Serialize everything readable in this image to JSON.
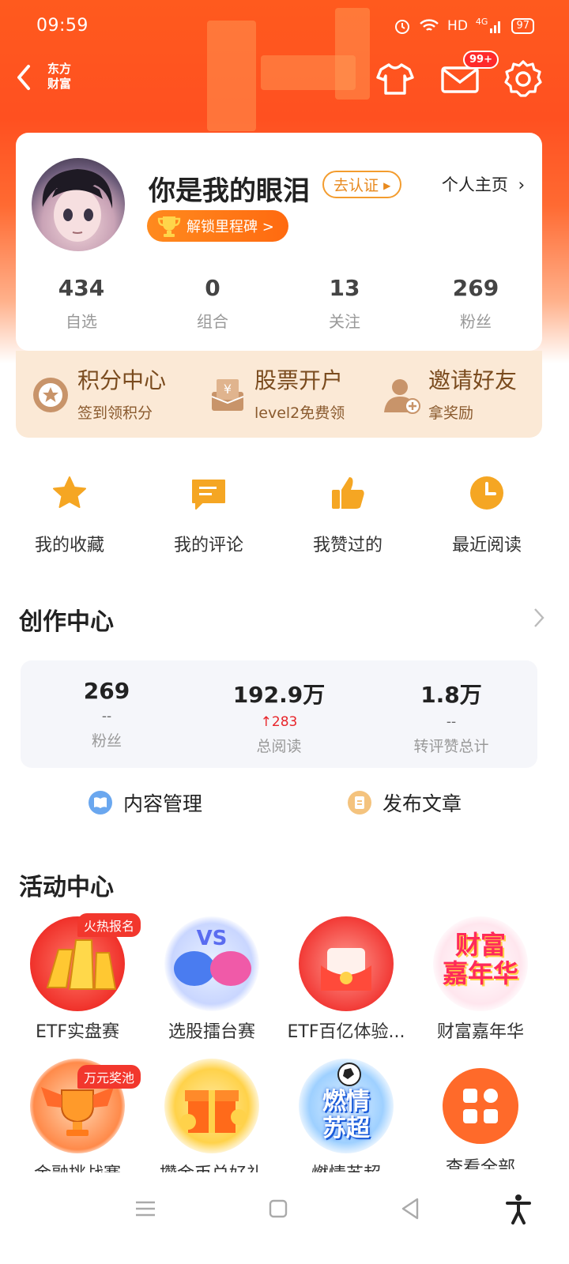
{
  "status": {
    "time": "09:59",
    "hd": "HD",
    "net": "4G",
    "battery": "97"
  },
  "topbar": {
    "logo_line1": "东方",
    "logo_line2": "财富",
    "msg_badge": "99+"
  },
  "profile": {
    "nickname": "你是我的眼泪",
    "verify_label": "去认证",
    "homepage_label": "个人主页",
    "milestone_label": "解锁里程碑 >",
    "stats": [
      {
        "value": "434",
        "label": "自选"
      },
      {
        "value": "0",
        "label": "组合"
      },
      {
        "value": "13",
        "label": "关注"
      },
      {
        "value": "269",
        "label": "粉丝"
      }
    ]
  },
  "benefits": [
    {
      "title": "积分中心",
      "sub": "签到领积分"
    },
    {
      "title": "股票开户",
      "sub": "level2免费领"
    },
    {
      "title": "邀请好友",
      "sub": "拿奖励"
    }
  ],
  "quick": [
    {
      "label": "我的收藏"
    },
    {
      "label": "我的评论"
    },
    {
      "label": "我赞过的"
    },
    {
      "label": "最近阅读"
    }
  ],
  "creator": {
    "title": "创作中心",
    "stats": [
      {
        "value": "269",
        "delta": "--",
        "label": "粉丝"
      },
      {
        "value": "192.9万",
        "delta": "283",
        "label": "总阅读"
      },
      {
        "value": "1.8万",
        "delta": "--",
        "label": "转评赞总计"
      }
    ],
    "manage_label": "内容管理",
    "publish_label": "发布文章"
  },
  "activity": {
    "title": "活动中心",
    "items": [
      {
        "label": "ETF实盘赛",
        "tag": "火热报名"
      },
      {
        "label": "选股擂台赛",
        "tag": ""
      },
      {
        "label": "ETF百亿体验...",
        "tag": ""
      },
      {
        "label": "财富嘉年华",
        "tag": ""
      },
      {
        "label": "金融挑战赛",
        "tag": "万元奖池"
      },
      {
        "label": "攒金币兑好礼",
        "tag": ""
      },
      {
        "label": "燃情苏超",
        "tag": ""
      },
      {
        "label": "查看全部",
        "tag": ""
      }
    ],
    "fortune_logo_line1": "财富",
    "fortune_logo_line2": "嘉年华",
    "supercup_logo_line1": "燃情",
    "supercup_logo_line2": "苏超"
  },
  "colors": {
    "accent": "#ff5a1e",
    "gold": "#f5a623",
    "up": "#e8252a"
  }
}
